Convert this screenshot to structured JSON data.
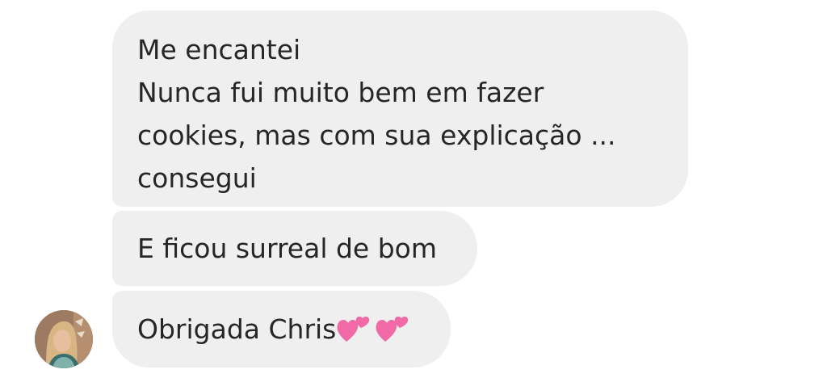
{
  "messages": [
    {
      "lines": [
        "Me encantei",
        "Nunca fui muito bem em fazer",
        "cookies,  mas com sua explicação ...",
        "consegui"
      ]
    },
    {
      "text": "E ficou surreal de bom"
    },
    {
      "text": "Obrigada Chris",
      "emoji": [
        "two-hearts-icon",
        "two-hearts-icon"
      ]
    }
  ],
  "colors": {
    "bubble": "#efefef",
    "text": "#262626",
    "heart": "#f06aa8",
    "background": "#ffffff"
  },
  "avatar": {
    "icon": "sender-avatar"
  }
}
